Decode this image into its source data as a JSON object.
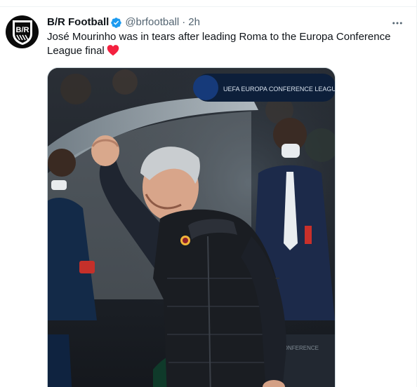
{
  "tweet": {
    "display_name": "B/R Football",
    "handle": "@brfootball",
    "separator": "·",
    "timestamp": "2h",
    "text": "José Mourinho was in tears after leading Roma to the Europa Conference League final",
    "emoji": "red-heart-emoji",
    "verified": true,
    "more_icon": "more-horizontal-icon"
  },
  "avatar": {
    "logo_text": "B/R",
    "icon": "br-logo-icon"
  },
  "media": {
    "description_icon": "photo",
    "banner_text": "UEFA EUROPA CONFERENCE LEAGUE",
    "board_text": "CONFERENCE"
  },
  "colors": {
    "verified": "#1d9bf0",
    "secondary_text": "#536471",
    "primary_text": "#0f1419",
    "heart": "#f91880",
    "border": "#eff3f4"
  }
}
